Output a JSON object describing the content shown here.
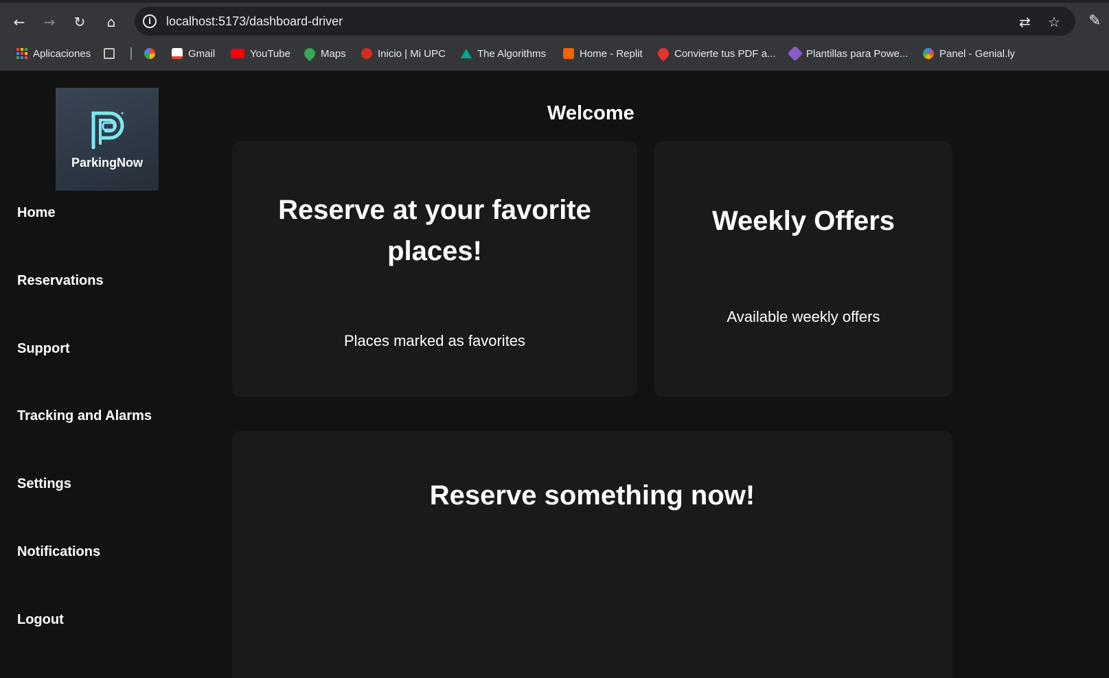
{
  "browser": {
    "url": "localhost:5173/dashboard-driver",
    "bookmarks": [
      {
        "label": "Aplicaciones",
        "icon": "apps-grid-icon"
      },
      {
        "label": "",
        "icon": "app-launcher-icon"
      },
      {
        "label": "",
        "icon": "pinwheel-icon"
      },
      {
        "label": "Gmail",
        "icon": "gmail-icon"
      },
      {
        "label": "YouTube",
        "icon": "youtube-icon"
      },
      {
        "label": "Maps",
        "icon": "maps-icon"
      },
      {
        "label": "Inicio | Mi UPC",
        "icon": "upc-icon"
      },
      {
        "label": "The Algorithms",
        "icon": "algorithms-icon"
      },
      {
        "label": "Home - Replit",
        "icon": "replit-icon"
      },
      {
        "label": "Convierte tus PDF a...",
        "icon": "heart-icon"
      },
      {
        "label": "Plantillas para Powe...",
        "icon": "slides-icon"
      },
      {
        "label": "Panel - Genial.ly",
        "icon": "genially-icon"
      }
    ]
  },
  "app": {
    "logo_text": "ParkingNow",
    "nav": [
      "Home",
      "Reservations",
      "Support",
      "Tracking and Alarms",
      "Settings",
      "Notifications",
      "Logout"
    ],
    "welcome": "Welcome",
    "cards": {
      "favorites": {
        "title_line1": "Reserve at your favorite",
        "title_line2": "places!",
        "subtitle": "Places marked as favorites"
      },
      "offers": {
        "title": "Weekly Offers",
        "subtitle": "Available weekly offers"
      },
      "reserve": {
        "title": "Reserve something now!"
      }
    }
  },
  "colors": {
    "accent": "#7ee8f0",
    "background": "#121212",
    "card": "#1a1a1d"
  }
}
